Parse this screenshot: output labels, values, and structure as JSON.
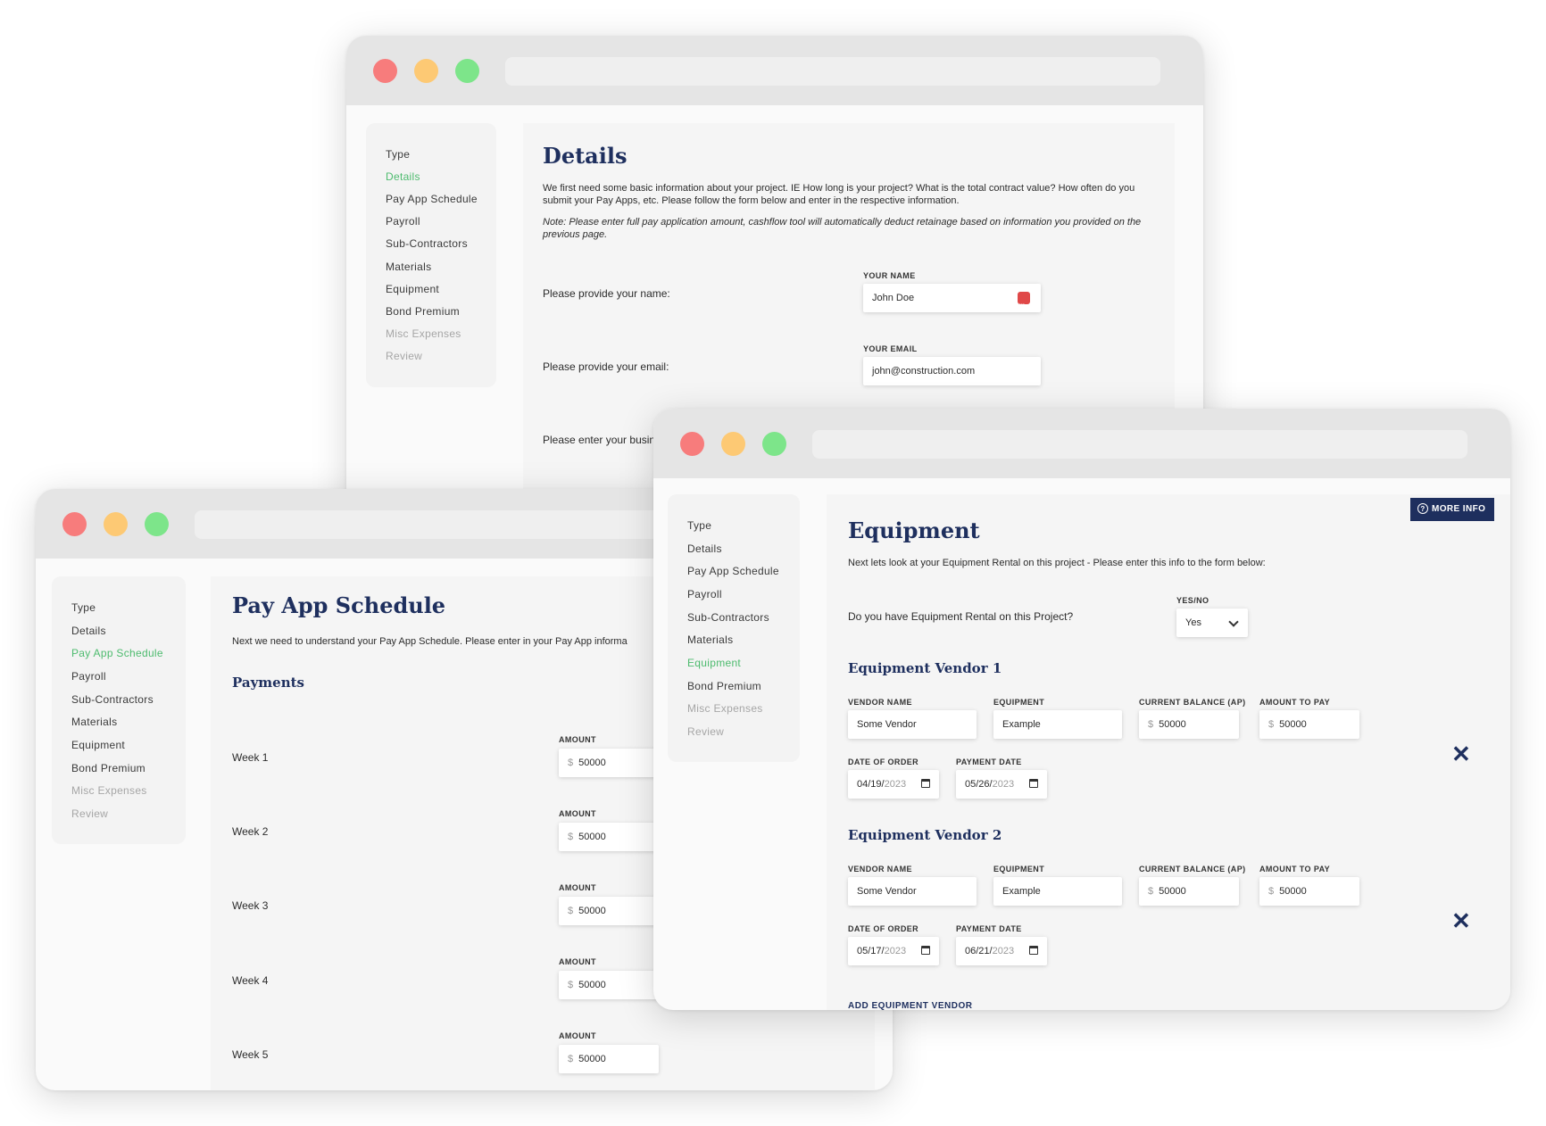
{
  "nav_labels": [
    "Type",
    "Details",
    "Pay App Schedule",
    "Payroll",
    "Sub-Contractors",
    "Materials",
    "Equipment",
    "Bond Premium",
    "Misc Expenses",
    "Review"
  ],
  "details_window": {
    "title": "Details",
    "intro": "We first need some basic information about your project. IE How long is your project? What is the total contract value? How often do you submit your Pay Apps, etc. Please follow the form below and enter in the respective information.",
    "note": "Note: Please enter full pay application amount, cashflow tool will automatically deduct retainage based on information you provided on the previous page.",
    "name_prompt": "Please provide your name:",
    "name_label": "YOUR NAME",
    "name_value": "John Doe",
    "email_prompt": "Please provide your email:",
    "email_label": "YOUR EMAIL",
    "email_value": "john@construction.com",
    "business_prompt": "Please enter your busine"
  },
  "payapp_window": {
    "title": "Pay App Schedule",
    "intro": "Next we need to understand your Pay App Schedule. Please enter in your Pay App informa",
    "section_title": "Payments",
    "currency_symbol": "$",
    "amount_label": "AMOUNT",
    "weeks": [
      {
        "label": "Week 1",
        "amount": "50000"
      },
      {
        "label": "Week 2",
        "amount": "50000"
      },
      {
        "label": "Week 3",
        "amount": "50000"
      },
      {
        "label": "Week 4",
        "amount": "50000"
      },
      {
        "label": "Week 5",
        "amount": "50000"
      }
    ]
  },
  "equipment_window": {
    "title": "Equipment",
    "more_info": "MORE INFO",
    "intro": "Next lets look at your Equipment Rental on this project - Please enter this info to the form below:",
    "question": "Do you have Equipment Rental on this Project?",
    "yesno_label": "YES/NO",
    "yesno_value": "Yes",
    "currency_symbol": "$",
    "field_labels": {
      "vendor_name": "VENDOR NAME",
      "equipment": "EQUIPMENT",
      "current_balance": "CURRENT BALANCE (AP)",
      "amount_to_pay": "AMOUNT TO PAY",
      "date_of_order": "DATE OF ORDER",
      "payment_date": "PAYMENT DATE"
    },
    "vendors": [
      {
        "title": "Equipment Vendor 1",
        "vendor_name": "Some Vendor",
        "equipment": "Example",
        "current_balance": "50000",
        "amount_to_pay": "50000",
        "order_md": "04/19/",
        "order_y": "2023",
        "payment_md": "05/26/",
        "payment_y": "2023"
      },
      {
        "title": "Equipment Vendor 2",
        "vendor_name": "Some Vendor",
        "equipment": "Example",
        "current_balance": "50000",
        "amount_to_pay": "50000",
        "order_md": "05/17/",
        "order_y": "2023",
        "payment_md": "06/21/",
        "payment_y": "2023"
      }
    ],
    "add_vendor": "ADD EQUIPMENT VENDOR"
  },
  "colors": {
    "accent_navy": "#1e2f5e",
    "active_green": "#4dbb6e",
    "traffic_red": "#f77c7c",
    "traffic_yellow": "#fdc974",
    "traffic_green": "#7de58a"
  }
}
